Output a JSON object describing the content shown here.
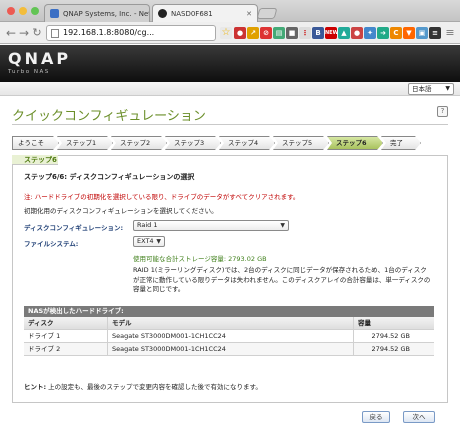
{
  "browser": {
    "tabs": [
      {
        "label": "QNAP Systems, Inc. - Netw",
        "active": false
      },
      {
        "label": "NASD0F681",
        "active": true
      }
    ],
    "address": "192.168.1.8:8080/cg...",
    "colors": {
      "close": "#ed5a52",
      "minimize": "#f3bd3b",
      "zoom": "#62c454"
    },
    "extensions": [
      "bookmark-icon",
      "abp-icon",
      "new-badge-icon",
      "honey-icon",
      "chart-icon",
      "camera-icon",
      "dots-icon",
      "car-icon",
      "globe-icon",
      "twitter-icon",
      "arrow-icon",
      "c-icon",
      "vlc-icon",
      "image-icon",
      "layers-icon"
    ]
  },
  "header": {
    "logo": "QNAP",
    "subtitle": "Turbo NAS"
  },
  "language": {
    "selected": "日本語"
  },
  "wizard": {
    "title": "クイックコンフィギュレーション",
    "steps": [
      "ようこそ",
      "ステップ1",
      "ステップ2",
      "ステップ3",
      "ステップ4",
      "ステップ5",
      "ステップ6",
      "完了"
    ],
    "active_step_index": 6,
    "panel_tab": "ステップ6"
  },
  "content": {
    "section_title": "ステップ6/6: ディスクコンフィギュレーションの選択",
    "warning": "注: ハードドライブの初期化を選択している限り、ドライブのデータがすべてクリアされます。",
    "description": "初期化用のディスクコンフィギュレーションを選択してください。",
    "disk_config_label": "ディスクコンフィギュレーション:",
    "disk_config_value": "Raid 1",
    "filesystem_label": "ファイルシステム:",
    "filesystem_value": "EXT4",
    "capacity": "使用可能な合計ストレージ容量: 2793.02 GB",
    "raid_note": "RAID 1(ミラーリングディスク)では、2台のディスクに同じデータが保存されるため、1台のディスクが正常に動作している限りデータは失われません。このディスクアレイの合計容量は、単一ディスクの容量と同じです。"
  },
  "drives_table": {
    "title": "NASが検出したハードドライブ:",
    "columns": [
      "ディスク",
      "モデル",
      "容量"
    ],
    "rows": [
      {
        "disk": "ドライブ 1",
        "model": "Seagate ST3000DM001-1CH1CC24",
        "capacity": "2794.52 GB"
      },
      {
        "disk": "ドライブ 2",
        "model": "Seagate ST3000DM001-1CH1CC24",
        "capacity": "2794.52 GB"
      }
    ]
  },
  "hint": {
    "label": "ヒント:",
    "text": " 上の設定も、最後のステップで変更内容を確認した後で有効になります。"
  },
  "buttons": {
    "back": "戻る",
    "next": "次へ"
  }
}
